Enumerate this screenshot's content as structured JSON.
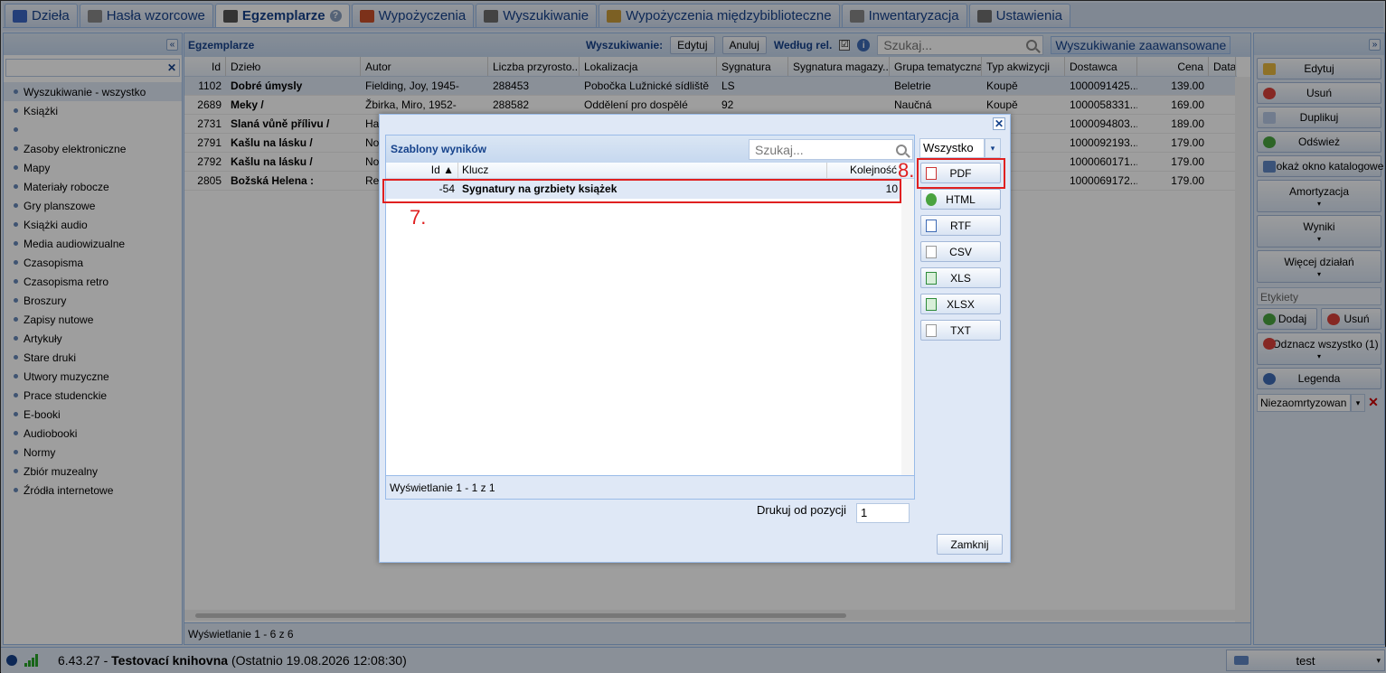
{
  "tabs": [
    {
      "label": "Dzieła",
      "icon": "book-icon",
      "color": "#3a66c4"
    },
    {
      "label": "Hasła wzorcowe",
      "icon": "card-icon",
      "color": "#8a8a8a"
    },
    {
      "label": "Egzemplarze",
      "icon": "barcode-scanner-icon",
      "color": "#555555",
      "active": true
    },
    {
      "label": "Wypożyczenia",
      "icon": "books-icon",
      "color": "#c94f2b"
    },
    {
      "label": "Wyszukiwanie",
      "icon": "search-box-icon",
      "color": "#6c6c6c"
    },
    {
      "label": "Wypożyczenia międzybiblioteczne",
      "icon": "package-icon",
      "color": "#c89b3a"
    },
    {
      "label": "Inwentaryzacja",
      "icon": "clipboard-icon",
      "color": "#888888"
    },
    {
      "label": "Ustawienia",
      "icon": "tools-icon",
      "color": "#707070"
    }
  ],
  "left": {
    "collapse": "«",
    "clear": "✕",
    "categories": [
      "Wyszukiwanie - wszystko",
      "Książki",
      "",
      "Zasoby elektroniczne",
      "Mapy",
      "Materiały robocze",
      "Gry planszowe",
      "Książki audio",
      "Media audiowizualne",
      "Czasopisma",
      "Czasopisma retro",
      "Broszury",
      "Zapisy nutowe",
      "Artykuły",
      "Stare druki",
      "Utwory muzyczne",
      "Prace studenckie",
      "E-booki",
      "Audiobooki",
      "Normy",
      "Zbiór muzealny",
      "Źródła internetowe"
    ]
  },
  "main": {
    "title": "Egzemplarze",
    "search_label": "Wyszukiwanie:",
    "edit": "Edytuj",
    "cancel": "Anuluj",
    "relevance": "Według rel.",
    "check": "☑",
    "search_placeholder": "Szukaj...",
    "advanced": "Wyszukiwanie zaawansowane",
    "columns": [
      "Id",
      "Dzieło",
      "Autor",
      "Liczba przyrosto...",
      "Lokalizacja",
      "Sygnatura",
      "Sygnatura magazy...",
      "Grupa tematyczna",
      "Typ akwizycji",
      "Dostawca",
      "Cena",
      "Data utw"
    ],
    "rows": [
      [
        "1102",
        "Dobré úmysly",
        "Fielding, Joy, 1945-",
        "288453",
        "Pobočka Lužnické sídliště",
        "LS",
        "",
        "Beletrie",
        "Koupě",
        "1000091425...",
        "139.00",
        ""
      ],
      [
        "2689",
        "Meky /",
        "Žbirka, Miro, 1952-",
        "288582",
        "Oddělení pro dospělé",
        "92",
        "",
        "Naučná",
        "Koupě",
        "1000058331...",
        "169.00",
        ""
      ],
      [
        "2731",
        "Slaná vůně přílivu /",
        "Ha",
        "",
        "",
        "",
        "",
        "",
        "",
        "1000094803...",
        "189.00",
        ""
      ],
      [
        "2791",
        "Kašlu na lásku /",
        "No",
        "",
        "",
        "",
        "",
        "",
        "",
        "1000092193...",
        "179.00",
        ""
      ],
      [
        "2792",
        "Kašlu na lásku /",
        "No",
        "",
        "",
        "",
        "",
        "",
        "",
        "1000060171...",
        "179.00",
        ""
      ],
      [
        "2805",
        "Božská Helena :",
        "Re",
        "",
        "",
        "",
        "",
        "",
        "",
        "1000069172...",
        "179.00",
        ""
      ]
    ],
    "footer": "Wyświetlanie 1 - 6 z 6"
  },
  "right": {
    "expand": "»",
    "edit": "Edytuj",
    "delete": "Usuń",
    "duplicate": "Duplikuj",
    "refresh": "Odśwież",
    "catalog": "Pokaż okno katalogowe",
    "amortization": "Amortyzacja",
    "results": "Wyniki",
    "more_actions": "Więcej działań",
    "labels_placeholder": "Etykiety",
    "add": "Dodaj",
    "remove": "Usuń",
    "unmark_all": "Odznacz wszystko (1)",
    "legend": "Legenda",
    "filter_value": "Niezaomrtyzowan",
    "arrow": "▾",
    "dd": "▾",
    "del": "✕"
  },
  "status": {
    "version": "6.43.27 - ",
    "library": "Testovací knihovna",
    "last": " (Ostatnio 19.08.2026 12:08:30)",
    "user": "test",
    "user_dd": "▾"
  },
  "dialog": {
    "close": "✕",
    "title": "Szablony wyników",
    "search_placeholder": "Szukaj...",
    "filter": "Wszystko",
    "filter_dd": "▾",
    "columns": [
      "Id ▲",
      "Klucz",
      "Kolejność"
    ],
    "rows": [
      [
        "-54",
        "Sygnatury na grzbiety książek",
        "10"
      ]
    ],
    "footer": "Wyświetlanie 1 - 1 z 1",
    "formats": [
      "PDF",
      "HTML",
      "RTF",
      "CSV",
      "XLS",
      "XLSX",
      "TXT"
    ],
    "print_from_label": "Drukuj od pozycji",
    "print_from_value": "1",
    "close_button": "Zamknij"
  },
  "annotations": {
    "row_marker": "7.",
    "pdf_marker": "8.",
    "color": "#e02020"
  }
}
